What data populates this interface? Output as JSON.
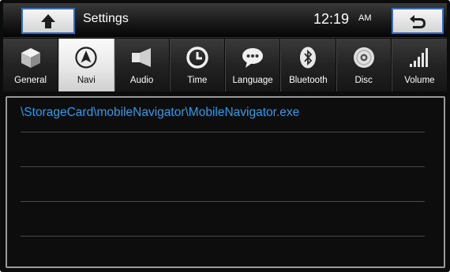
{
  "header": {
    "title": "Settings",
    "time": "12:19",
    "ampm": "AM",
    "home_icon": "home-arrow-icon",
    "back_icon": "back-return-icon"
  },
  "tabs": [
    {
      "label": "General",
      "icon": "cube-icon",
      "active": false
    },
    {
      "label": "Navi",
      "icon": "navigation-arrow-icon",
      "active": true
    },
    {
      "label": "Audio",
      "icon": "speaker-icon",
      "active": false
    },
    {
      "label": "Time",
      "icon": "clock-icon",
      "active": false
    },
    {
      "label": "Language",
      "icon": "speech-bubble-icon",
      "active": false
    },
    {
      "label": "Bluetooth",
      "icon": "bluetooth-icon",
      "active": false
    },
    {
      "label": "Disc",
      "icon": "disc-icon",
      "active": false
    },
    {
      "label": "Volume",
      "icon": "volume-bars-icon",
      "active": false
    }
  ],
  "navi_paths": [
    "\\StorageCard\\mobileNavigator\\MobileNavigator.exe",
    "",
    "",
    ""
  ],
  "colors": {
    "accent": "#2f6fc8",
    "path_text": "#2f9be8",
    "background": "#0c0c0c"
  }
}
